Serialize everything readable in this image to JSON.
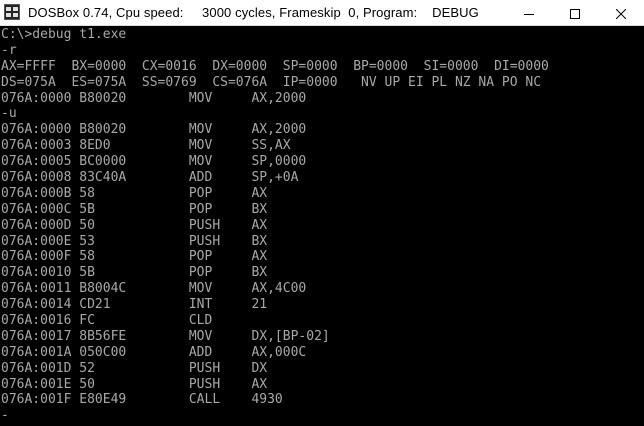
{
  "window": {
    "title": "DOSBox 0.74, Cpu speed:     3000 cycles, Frameskip  0, Program:    DEBUG",
    "icon": "dosbox-icon",
    "controls": {
      "minimize": "minimize-icon",
      "maximize": "maximize-icon",
      "close": "close-icon"
    }
  },
  "colors": {
    "terminal_bg": "#000000",
    "terminal_fg": "#a8a8a8",
    "titlebar_bg": "#ffffff"
  },
  "terminal": {
    "lines": [
      "C:\\>debug t1.exe",
      "-r",
      "AX=FFFF  BX=0000  CX=0016  DX=0000  SP=0000  BP=0000  SI=0000  DI=0000",
      "DS=075A  ES=075A  SS=0769  CS=076A  IP=0000   NV UP EI PL NZ NA PO NC",
      "076A:0000 B80020        MOV     AX,2000",
      "-u",
      "076A:0000 B80020        MOV     AX,2000",
      "076A:0003 8ED0          MOV     SS,AX",
      "076A:0005 BC0000        MOV     SP,0000",
      "076A:0008 83C40A        ADD     SP,+0A",
      "076A:000B 58            POP     AX",
      "076A:000C 5B            POP     BX",
      "076A:000D 50            PUSH    AX",
      "076A:000E 53            PUSH    BX",
      "076A:000F 58            POP     AX",
      "076A:0010 5B            POP     BX",
      "076A:0011 B8004C        MOV     AX,4C00",
      "076A:0014 CD21          INT     21",
      "076A:0016 FC            CLD",
      "076A:0017 8B56FE        MOV     DX,[BP-02]",
      "076A:001A 050C00        ADD     AX,000C",
      "076A:001D 52            PUSH    DX",
      "076A:001E 50            PUSH    AX",
      "076A:001F E80E49        CALL    4930",
      "-"
    ]
  }
}
